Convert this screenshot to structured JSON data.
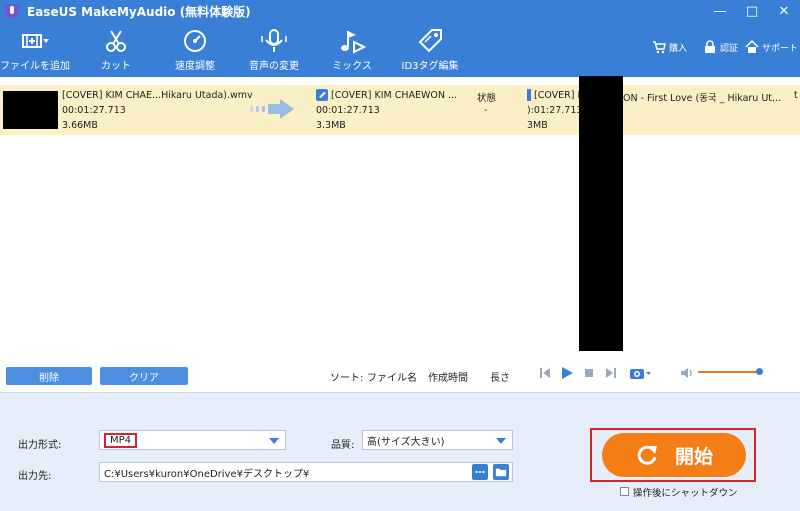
{
  "window": {
    "title": "EaseUS MakeMyAudio (無料体験版)",
    "controls": [
      "—",
      "□",
      "✕"
    ]
  },
  "toolbar": {
    "tools": [
      {
        "label": "ファイルを追加",
        "icon": "add-file-icon"
      },
      {
        "label": "カット",
        "icon": "scissors-icon"
      },
      {
        "label": "速度調整",
        "icon": "speed-dial-icon"
      },
      {
        "label": "音声の変更",
        "icon": "microphone-icon"
      },
      {
        "label": "ミックス",
        "icon": "music-note-icon"
      },
      {
        "label": "ID3タグ編集",
        "icon": "tag-icon"
      }
    ],
    "right": [
      {
        "label": "購入",
        "icon": "cart-icon"
      },
      {
        "label": "認証",
        "icon": "lock-icon"
      },
      {
        "label": "サポート",
        "icon": "home-icon"
      }
    ]
  },
  "file": {
    "source_name": "[COVER] KIM CHAE...Hikaru Utada).wmv",
    "source_duration": "00:01:27.713",
    "source_size": "3.66MB",
    "output_name": "[COVER] KIM CHAEWON ...",
    "output_duration": "00:01:27.713",
    "output_size": "3.3MB",
    "status_label": "状態",
    "status_value": "-",
    "right_name": "[COVER] K",
    "right_name_tail": "ON - First Love (동국 _ Hikaru Ut...",
    "right_duration": "):01:27.713",
    "right_size": "3MB",
    "edge_char": "t"
  },
  "controls": {
    "delete_label": "削除",
    "clear_label": "クリア",
    "sort_label": "ソート:",
    "sort_options": [
      "ファイル名",
      "作成時間",
      "長さ"
    ]
  },
  "output": {
    "format_label": "出力形式:",
    "format_value": "MP4",
    "quality_label": "品質:",
    "quality_value": "高(サイズ大きい)",
    "dest_label": "出力先:",
    "dest_value": "C:¥Users¥kuron¥OneDrive¥デスクトップ¥"
  },
  "start": {
    "label": "開始",
    "shutdown_label": "操作後にシャットダウン"
  },
  "colors": {
    "header_blue": "#3a7fd6",
    "row_highlight": "#fbf0c5",
    "start_orange": "#f47d16",
    "annotation_red": "#d8232a"
  }
}
